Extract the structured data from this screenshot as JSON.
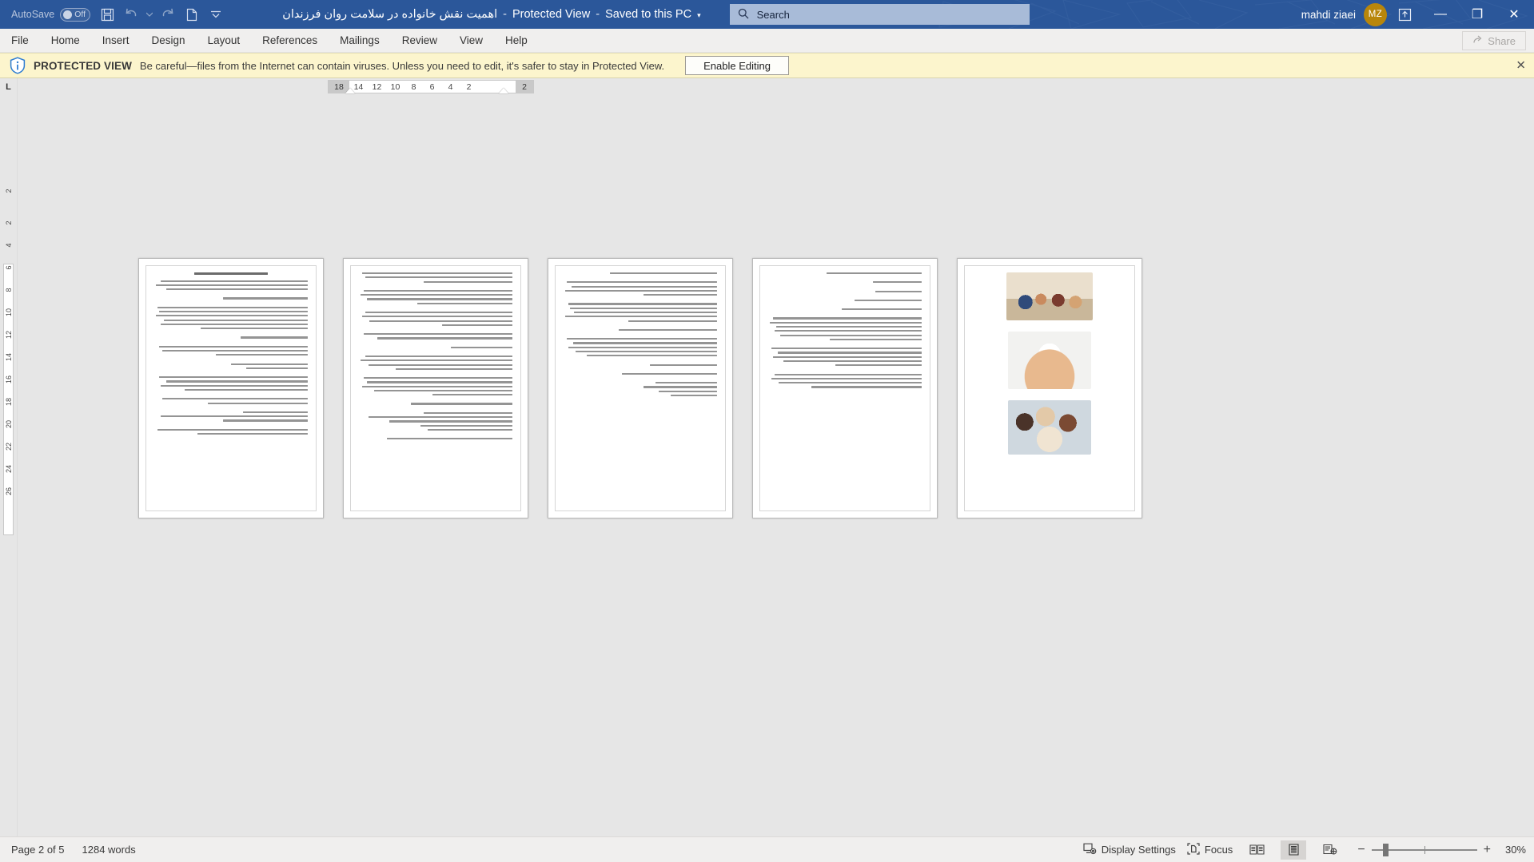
{
  "titlebar": {
    "autosave_label": "AutoSave",
    "autosave_state": "Off",
    "quick_access": [
      {
        "name": "save-icon",
        "label": "Save"
      },
      {
        "name": "undo-icon",
        "label": "Undo"
      },
      {
        "name": "undo-dropdown-icon",
        "label": "Undo options"
      },
      {
        "name": "redo-icon",
        "label": "Redo"
      },
      {
        "name": "new-document-icon",
        "label": "New"
      },
      {
        "name": "customize-qat-icon",
        "label": "Customize Quick Access Toolbar"
      }
    ],
    "document_name": "اهمیت نقش خانواده در سلامت روان فرزندان",
    "protected_view_label": "Protected View",
    "save_state": "Saved to this PC",
    "separator": "-",
    "title_caret": "▾",
    "search_placeholder": "Search",
    "search_icon": "search-icon",
    "user_name": "mahdi ziaei",
    "user_initials": "MZ",
    "ribbon_display_icon": "ribbon-display-options-icon",
    "minimize": "—",
    "restore": "❐",
    "close": "✕"
  },
  "ribbon": {
    "tabs": [
      {
        "label": "File",
        "name": "tab-file"
      },
      {
        "label": "Home",
        "name": "tab-home"
      },
      {
        "label": "Insert",
        "name": "tab-insert"
      },
      {
        "label": "Design",
        "name": "tab-design"
      },
      {
        "label": "Layout",
        "name": "tab-layout"
      },
      {
        "label": "References",
        "name": "tab-references"
      },
      {
        "label": "Mailings",
        "name": "tab-mailings"
      },
      {
        "label": "Review",
        "name": "tab-review"
      },
      {
        "label": "View",
        "name": "tab-view"
      },
      {
        "label": "Help",
        "name": "tab-help"
      }
    ],
    "share_label": "Share",
    "share_icon": "share-icon"
  },
  "protected_view": {
    "icon": "shield-info-icon",
    "strong": "PROTECTED VIEW",
    "message": "Be careful—files from the Internet can contain viruses. Unless you need to edit, it's safer to stay in Protected View.",
    "enable_button": "Enable Editing",
    "close_icon": "close-icon",
    "close_glyph": "✕",
    "bar_color": "#fcf5cd"
  },
  "ruler": {
    "tab_selector": "L",
    "horizontal_ticks": [
      "18",
      "14",
      "12",
      "10",
      "8",
      "6",
      "4",
      "2",
      "2"
    ],
    "vertical_ticks": [
      "2",
      "2",
      "4",
      "6",
      "8",
      "10",
      "12",
      "14",
      "16",
      "18",
      "20",
      "22",
      "24",
      "26"
    ]
  },
  "document": {
    "page_count_visible": 5,
    "pages": [
      {
        "name": "page-thumbnail-1",
        "has_images": false
      },
      {
        "name": "page-thumbnail-2",
        "has_images": false
      },
      {
        "name": "page-thumbnail-3",
        "has_images": false
      },
      {
        "name": "page-thumbnail-4",
        "has_images": false
      },
      {
        "name": "page-thumbnail-5",
        "has_images": true
      }
    ]
  },
  "statusbar": {
    "page_status": "Page 2 of 5",
    "word_count": "1284 words",
    "display_settings": "Display Settings",
    "display_settings_icon": "display-settings-icon",
    "focus": "Focus",
    "focus_icon": "focus-icon",
    "views": [
      {
        "name": "read-mode-button",
        "label": "Read Mode",
        "active": false
      },
      {
        "name": "print-layout-button",
        "label": "Print Layout",
        "active": true
      },
      {
        "name": "web-layout-button",
        "label": "Web Layout",
        "active": false
      }
    ],
    "zoom_out": "−",
    "zoom_in": "+",
    "zoom_level": "30%"
  }
}
